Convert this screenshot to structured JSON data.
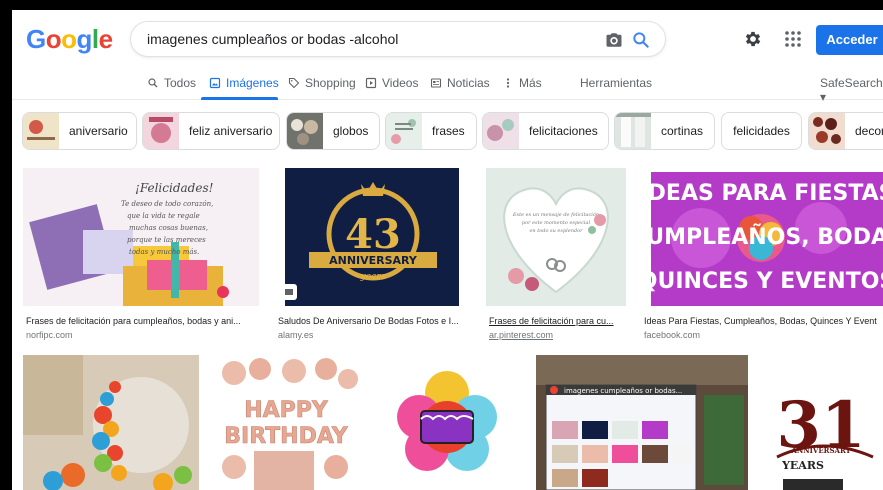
{
  "header": {
    "logo_letters": [
      {
        "ch": "G",
        "color": "#4285f4"
      },
      {
        "ch": "o",
        "color": "#ea4335"
      },
      {
        "ch": "o",
        "color": "#fbbc05"
      },
      {
        "ch": "g",
        "color": "#4285f4"
      },
      {
        "ch": "l",
        "color": "#34a853"
      },
      {
        "ch": "e",
        "color": "#ea4335"
      }
    ],
    "search_query": "imagenes cumpleaños or bodas -alcohol",
    "signin_label": "Acceder"
  },
  "nav": {
    "items": [
      {
        "label": "Todos",
        "icon": "search-icon"
      },
      {
        "label": "Imágenes",
        "icon": "image-icon",
        "active": true
      },
      {
        "label": "Shopping",
        "icon": "tag-icon"
      },
      {
        "label": "Videos",
        "icon": "play-icon"
      },
      {
        "label": "Noticias",
        "icon": "news-icon"
      },
      {
        "label": "Más",
        "icon": "more-vert-icon"
      }
    ],
    "tools_label": "Herramientas",
    "safesearch_label": "SafeSearch ▾"
  },
  "chips": [
    {
      "label": "aniversario",
      "thumb": "#c9a88a"
    },
    {
      "label": "feliz aniversario",
      "thumb": "#d9a4b4"
    },
    {
      "label": "globos",
      "thumb": "#8a8f86"
    },
    {
      "label": "frases",
      "thumb": "#c8d8cf"
    },
    {
      "label": "felicitaciones",
      "thumb": "#d6b4c4"
    },
    {
      "label": "cortinas",
      "thumb": "#cfd6d2"
    },
    {
      "label": "felicidades",
      "thumb": ""
    },
    {
      "label": "decor",
      "thumb": "#7a3a2a"
    }
  ],
  "results_row1": [
    {
      "title": "Frases de felicitación para cumpleaños, bodas y ani...",
      "site": "norfipc.com",
      "overlay_text": "¡Felicidades! Te deseo de todo corazón, que la vida te regale muchas cosas buenas, porque te las mereces todas y mucho más."
    },
    {
      "title": "Saludos De Aniversario De Bodas Fotos e I...",
      "site": "alamy.es",
      "overlay_number": "43",
      "overlay_label": "ANNIVERSARY",
      "overlay_sub": "years"
    },
    {
      "title": "Frases de felicitación para cu...",
      "site": "ar.pinterest.com"
    },
    {
      "title": "Ideas Para Fiestas, Cumpleaños, Bodas, Quinces Y Event",
      "site": "facebook.com",
      "overlay_text": "IDEAS PARA FIESTAS CUMPLEAÑOS, BODAS QUINCES Y EVENTOS"
    }
  ],
  "results_row2": [
    {
      "alt": "balloon arch"
    },
    {
      "alt": "happy birthday balloons",
      "overlay_text": "HAPPY BIRTHDAY"
    },
    {
      "alt": "cake icon"
    },
    {
      "alt": "screenshot",
      "overlay_text": "imagenes cumpleaños or bodas..."
    },
    {
      "alt": "31 anniversary",
      "overlay_number": "31",
      "overlay_label": "ANNIVERSARY",
      "overlay_sub": "YEARS"
    }
  ]
}
